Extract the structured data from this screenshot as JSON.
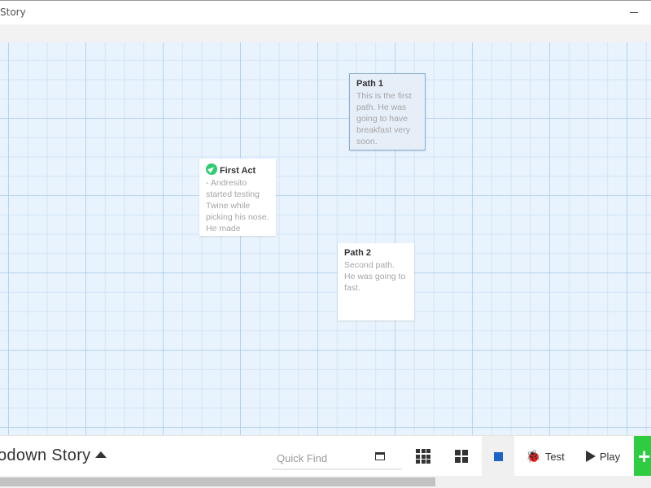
{
  "window": {
    "title": "Story"
  },
  "passages": [
    {
      "title": "Path 1",
      "excerpt": "This is the first path. He was going to have breakfast very soon.",
      "selected": true,
      "start": false
    },
    {
      "title": "First Act",
      "excerpt": "- Andresito started testing Twine while picking his nose. He made",
      "selected": false,
      "start": true
    },
    {
      "title": "Path 2",
      "excerpt": "Second path. He was going to fast.",
      "selected": false,
      "start": false
    }
  ],
  "toolbar": {
    "story_name": "odown Story",
    "quick_find_placeholder": "Quick Find",
    "test_label": "Test",
    "play_label": "Play",
    "add_label": "+"
  },
  "icons": {
    "start": "rocket-icon",
    "detail": "passage-detail-icon",
    "grid_small": "grid-9-icon",
    "grid_medium": "grid-4-icon",
    "grid_large": "square-icon",
    "test": "bug-icon",
    "play": "play-icon",
    "add": "plus-icon",
    "story_menu": "caret-up-icon"
  },
  "colors": {
    "accent_green": "#2ecc40",
    "zoom_selected": "#1a64c8",
    "grid_bg": "#e9f3fd"
  }
}
